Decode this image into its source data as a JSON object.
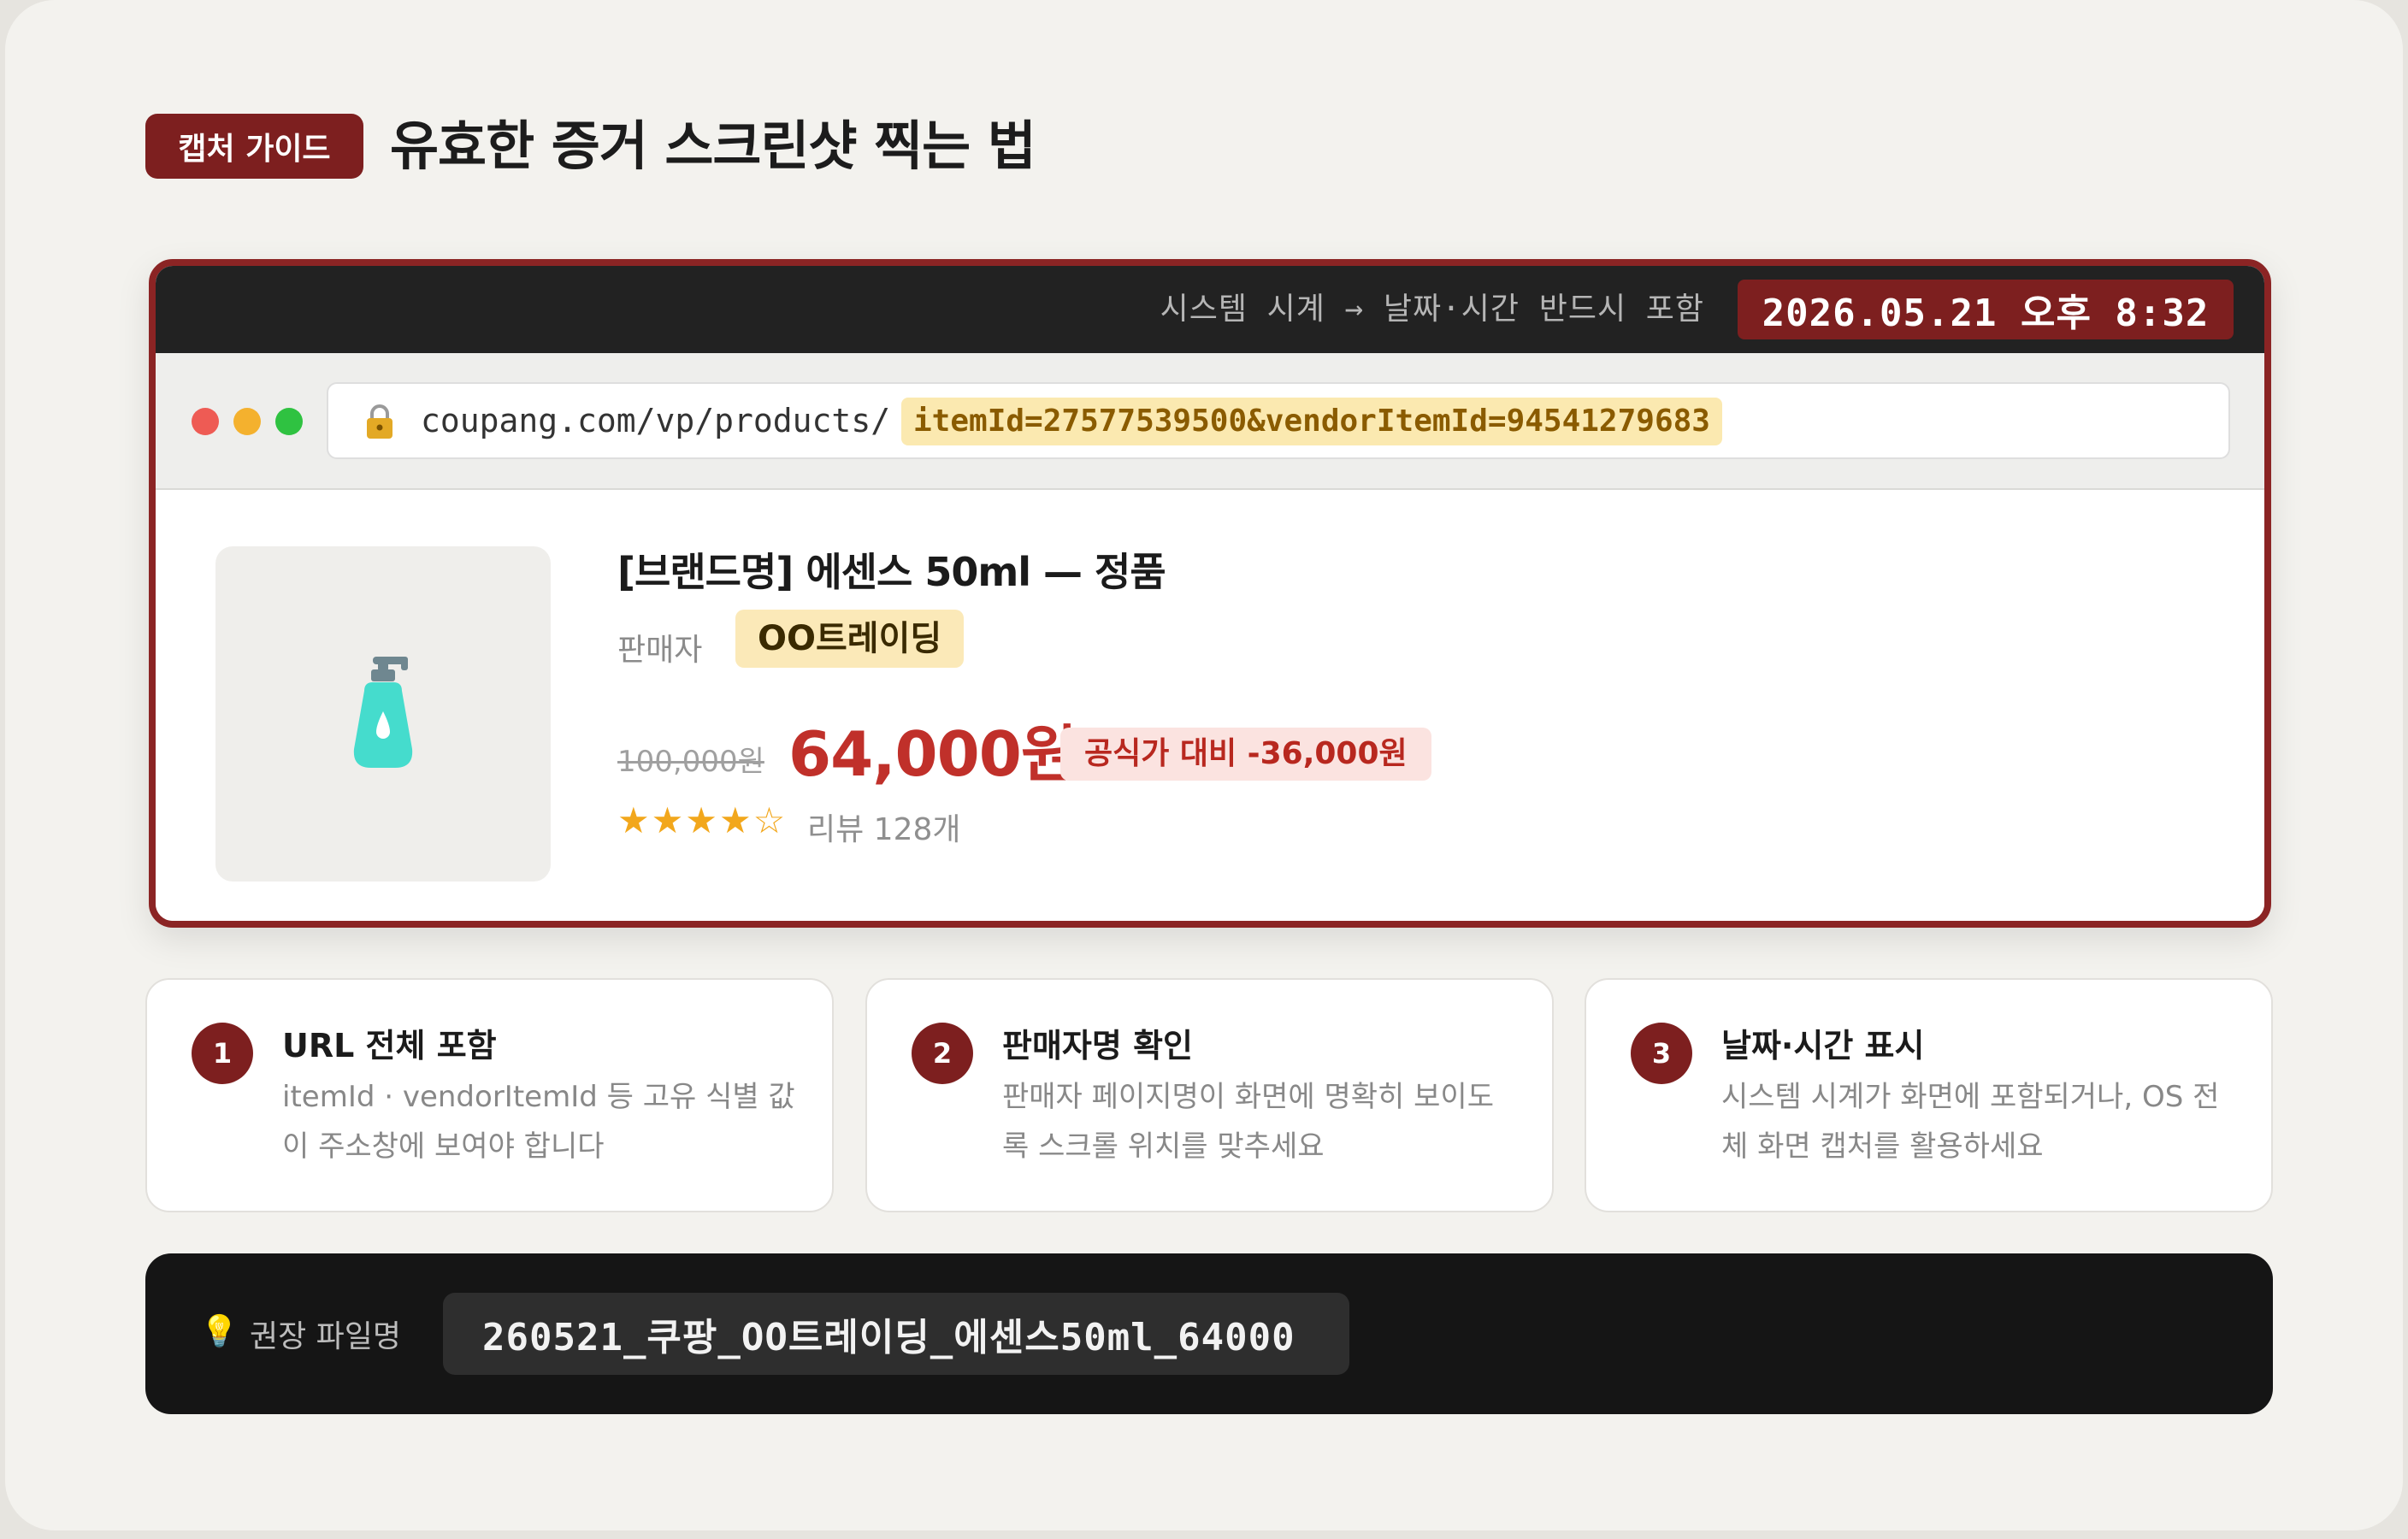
{
  "header": {
    "badge": "캡처 가이드",
    "title": "유효한 증거 스크린샷 찍는 법"
  },
  "browser": {
    "clock_hint": "시스템 시계 → 날짜·시간 반드시 포함",
    "clock_time": "2026.05.21  오후 8:32",
    "url_base": "coupang.com/vp/products/",
    "url_params": "itemId=27577539500&vendorItemId=94541279683",
    "icons": {
      "lock": "lock-icon",
      "product": "pump-bottle-icon"
    }
  },
  "product": {
    "name": "[브랜드명] 에센스 50ml — 정품",
    "seller_label": "판매자",
    "seller_name": "OO트레이딩",
    "original_price": "100,000원",
    "sale_price": "64,000원",
    "discount": "공식가 대비 -36,000원",
    "stars": "★★★★☆",
    "rating": 4,
    "rating_max": 5,
    "reviews": "리뷰 128개"
  },
  "tips": [
    {
      "num": "1",
      "title": "URL 전체 포함",
      "body": "itemId · vendorItemId 등 고유 식별 값이 주소창에 보여야 합니다"
    },
    {
      "num": "2",
      "title": "판매자명 확인",
      "body": "판매자 페이지명이 화면에 명확히 보이도록 스크롤 위치를 맞추세요"
    },
    {
      "num": "3",
      "title": "날짜·시간 표시",
      "body": "시스템 시계가 화면에 포함되거나, OS 전체 화면 캡처를 활용하세요"
    }
  ],
  "filename": {
    "icon": "💡",
    "label": "권장 파일명",
    "value": "260521_쿠팡_OO트레이딩_에센스50ml_64000"
  },
  "colors": {
    "accent": "#7d1f1f",
    "price": "#c0302a",
    "highlight": "#fbe9b0",
    "star": "#f2a71c"
  }
}
